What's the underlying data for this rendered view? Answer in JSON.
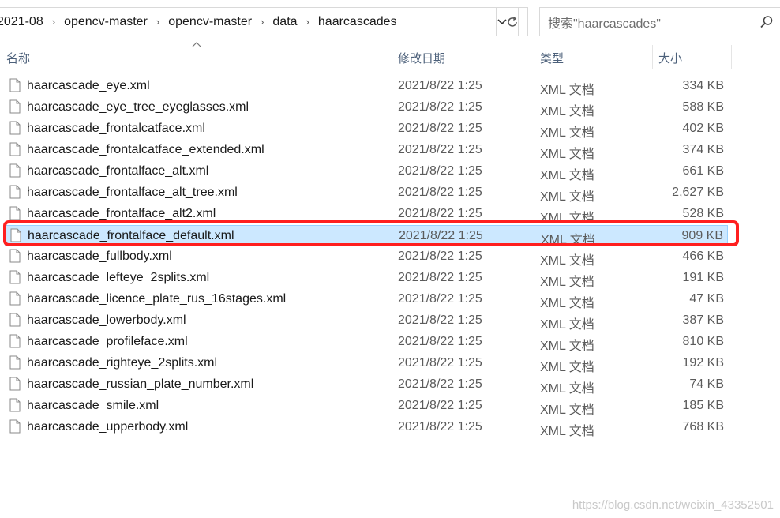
{
  "address": {
    "crumbs": [
      "2021-08",
      "opencv-master",
      "opencv-master",
      "data",
      "haarcascades"
    ]
  },
  "search": {
    "placeholder": "搜索\"haarcascades\""
  },
  "columns": {
    "name": "名称",
    "date": "修改日期",
    "type": "类型",
    "size": "大小"
  },
  "files": [
    {
      "name": "haarcascade_eye.xml",
      "date": "2021/8/22 1:25",
      "type": "XML 文档",
      "size": "334 KB"
    },
    {
      "name": "haarcascade_eye_tree_eyeglasses.xml",
      "date": "2021/8/22 1:25",
      "type": "XML 文档",
      "size": "588 KB"
    },
    {
      "name": "haarcascade_frontalcatface.xml",
      "date": "2021/8/22 1:25",
      "type": "XML 文档",
      "size": "402 KB"
    },
    {
      "name": "haarcascade_frontalcatface_extended.xml",
      "date": "2021/8/22 1:25",
      "type": "XML 文档",
      "size": "374 KB"
    },
    {
      "name": "haarcascade_frontalface_alt.xml",
      "date": "2021/8/22 1:25",
      "type": "XML 文档",
      "size": "661 KB"
    },
    {
      "name": "haarcascade_frontalface_alt_tree.xml",
      "date": "2021/8/22 1:25",
      "type": "XML 文档",
      "size": "2,627 KB"
    },
    {
      "name": "haarcascade_frontalface_alt2.xml",
      "date": "2021/8/22 1:25",
      "type": "XML 文档",
      "size": "528 KB"
    },
    {
      "name": "haarcascade_frontalface_default.xml",
      "date": "2021/8/22 1:25",
      "type": "XML 文档",
      "size": "909 KB",
      "selected": true
    },
    {
      "name": "haarcascade_fullbody.xml",
      "date": "2021/8/22 1:25",
      "type": "XML 文档",
      "size": "466 KB"
    },
    {
      "name": "haarcascade_lefteye_2splits.xml",
      "date": "2021/8/22 1:25",
      "type": "XML 文档",
      "size": "191 KB"
    },
    {
      "name": "haarcascade_licence_plate_rus_16stages.xml",
      "date": "2021/8/22 1:25",
      "type": "XML 文档",
      "size": "47 KB"
    },
    {
      "name": "haarcascade_lowerbody.xml",
      "date": "2021/8/22 1:25",
      "type": "XML 文档",
      "size": "387 KB"
    },
    {
      "name": "haarcascade_profileface.xml",
      "date": "2021/8/22 1:25",
      "type": "XML 文档",
      "size": "810 KB"
    },
    {
      "name": "haarcascade_righteye_2splits.xml",
      "date": "2021/8/22 1:25",
      "type": "XML 文档",
      "size": "192 KB"
    },
    {
      "name": "haarcascade_russian_plate_number.xml",
      "date": "2021/8/22 1:25",
      "type": "XML 文档",
      "size": "74 KB"
    },
    {
      "name": "haarcascade_smile.xml",
      "date": "2021/8/22 1:25",
      "type": "XML 文档",
      "size": "185 KB"
    },
    {
      "name": "haarcascade_upperbody.xml",
      "date": "2021/8/22 1:25",
      "type": "XML 文档",
      "size": "768 KB"
    }
  ],
  "watermark": "https://blog.csdn.net/weixin_43352501",
  "colors": {
    "selection": "#cce8ff",
    "highlight_border": "#ff1f1f",
    "header_text": "#4c607a"
  },
  "icons": {
    "file": "document-icon",
    "dropdown": "chevron-down-icon",
    "refresh": "refresh-icon",
    "search": "search-icon",
    "sort": "sort-up-icon"
  }
}
